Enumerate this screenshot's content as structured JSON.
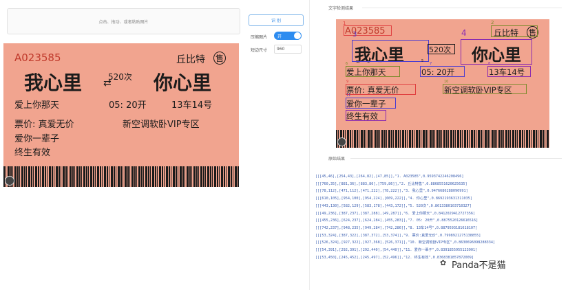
{
  "upload": {
    "hint": "点击、拖动、或者粘贴图片"
  },
  "controls": {
    "recognize_label": "识 别",
    "compress_label": "压缩图片",
    "toggle_text": "开",
    "size_label": "短边尺寸",
    "size_value": "960"
  },
  "sections": {
    "detection_title": "文字检测结果",
    "raw_title": "原始结果"
  },
  "ticket": {
    "serial": "A023585",
    "station": "丘比特",
    "sale": "售",
    "from": "我心里",
    "train": "520次",
    "to": "你心里",
    "date": "爱上你那天",
    "time": "05: 20开",
    "seat": "13车14号",
    "price": "票价: 真爱无价",
    "class": "新空调软卧VIP专区",
    "line1": "爱你一辈子",
    "line2": "终生有效"
  },
  "box_labels": [
    "1",
    "2",
    "3",
    "4",
    "5",
    "6",
    "7",
    "8",
    "9",
    "10",
    "11",
    "12"
  ],
  "colors": {
    "accent": "#2d8cf0",
    "ticket_bg": "#f1a48f",
    "box_red": "#e04040",
    "box_blue": "#4a3cd0",
    "box_green": "#7a8a2a",
    "box_purple": "#8a2ab0"
  },
  "raw_results": [
    "[[[45,46],[254,43],[264,82],[47,85]],\"1. A023585\",0.9593742246208496]",
    "[[[760,35],[881,36],[883,86],[759,86]],\"2. 丘比特售\",0.8868551620625635]",
    "[[[78,112],[471,112],[471,222],[78,222]],\"3. 我心里\",0.9476686288090991]",
    "[[[610,105],[954,100],[954,224],[609,222]],\"4. 你心里\",0.8692193631311035]",
    "[[[443,130],[582,129],[583,178],[443,172]],\"5. 520次\",0.8613380103710327]",
    "[[[49,236],[387,237],[387,288],[49,287]],\"6. 爱上你那天\",0.8412029412727356]",
    "[[[455,236],[624,237],[624,284],[455,283]],\"7. 05: 20开\",0.8875520126616516]",
    "[[[742,237],[948,235],[949,284],[742,286]],\"8. 13车14号\",0.8879593181618107]",
    "[[[53,324],[387,322],[387,372],[53,374]],\"9. 票价:真爱无价\",0.7998921275138855]",
    "[[[526,324],[927,322],[927,368],[526,371]],\"10. 新空调软卧VIP专区\",0.8630696098288334]",
    "[[[54,391],[292,391],[292,440],[54,440]],\"11. 爱你一辈子\",0.8391855955123901]",
    "[[[53,450],[245,452],[245,497],[52,496]],\"12. 终生有效\",0.8368381857872009]"
  ],
  "watermark": "Panda不是猫"
}
